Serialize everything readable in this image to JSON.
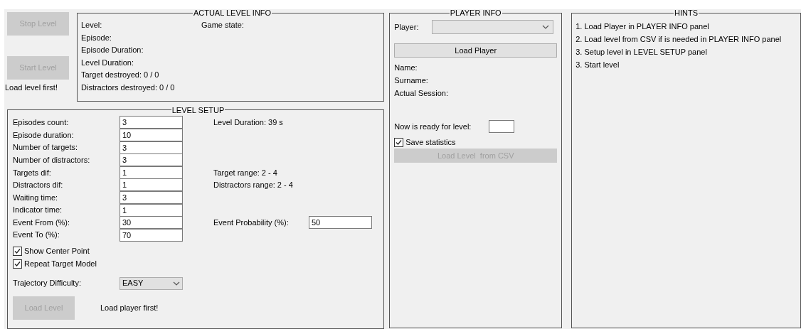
{
  "control_buttons": [
    {
      "label": "Stop Level",
      "disabled": true
    },
    {
      "label": "Start Level",
      "disabled": true
    }
  ],
  "level_message": "Load level first!",
  "actual_level_info": {
    "title": "ACTUAL LEVEL INFO",
    "left_lines": [
      "Level:",
      "Episode:",
      "Episode Duration:",
      "Level Duration:",
      "Target destroyed: 0 / 0",
      "Distractors destroyed: 0 / 0"
    ],
    "right_lines": [
      "Game state:"
    ]
  },
  "level_setup": {
    "title": "LEVEL SETUP",
    "fields": [
      {
        "label": "Episodes count:",
        "value": "3",
        "side_text": "Level Duration: 39 s"
      },
      {
        "label": "Episode duration:",
        "value": "10"
      },
      {
        "label": "Number of targets:",
        "value": "3"
      },
      {
        "label": "Number of distractors:",
        "value": "3"
      },
      {
        "label": "Targets dif:",
        "value": "1",
        "side_text": "Target range: 2 - 4"
      },
      {
        "label": "Distractors dif:",
        "value": "1",
        "side_text": "Distractors range: 2 - 4"
      },
      {
        "label": "Waiting time:",
        "value": "3"
      },
      {
        "label": "Indicator time:",
        "value": "1"
      },
      {
        "label": "Event From (%):",
        "value": "30",
        "side_text": "Event Probability (%):",
        "side_value": "50"
      },
      {
        "label": "Event To (%):",
        "value": "70"
      }
    ],
    "checkboxes": [
      {
        "label": "Show Center Point",
        "checked": true
      },
      {
        "label": "Repeat Target Model",
        "checked": true
      }
    ],
    "trajectory": {
      "label": "Trajectory Difficulty:",
      "value": "EASY"
    },
    "load_button": {
      "label": "Load Level",
      "disabled": true
    },
    "message": "Load player first!"
  },
  "player_info": {
    "title": "PLAYER INFO",
    "player_label": "Player:",
    "load_button": {
      "label": "Load Player",
      "disabled": false
    },
    "info_lines": [
      "Name:",
      "Surname:",
      "Actual Session:"
    ],
    "ready_label": "Now is ready for level:",
    "save_statistics": {
      "label": "Save statistics",
      "checked": true
    },
    "csv_button": {
      "label": "Load Level  from CSV",
      "disabled": true
    }
  },
  "hints": {
    "title": "HINTS",
    "items": [
      "1. Load Player in PLAYER INFO panel",
      "2. Load level from CSV if is needed in PLAYER INFO panel",
      "3. Setup level in LEVEL SETUP panel",
      "3. Start level"
    ]
  }
}
